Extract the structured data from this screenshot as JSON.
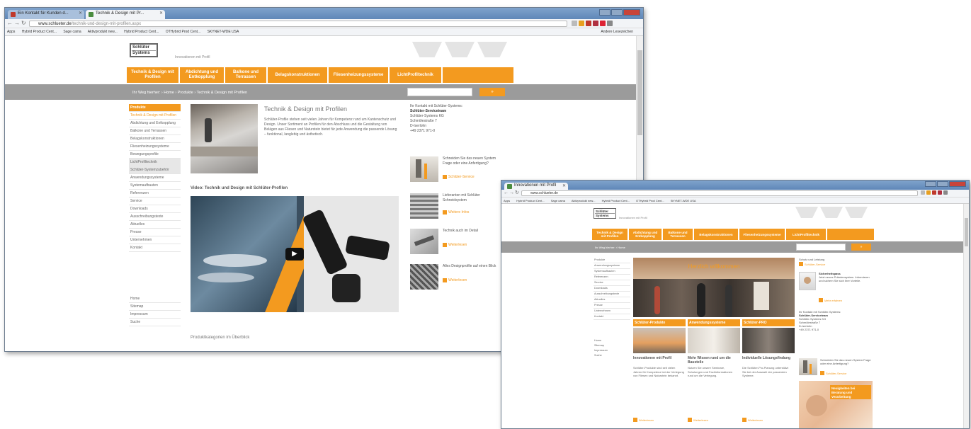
{
  "colors": {
    "accent": "#f39a1f",
    "gray_bar": "#9b9b9b",
    "titlebar": "#6b8fbf"
  },
  "window1": {
    "tabs": [
      {
        "label": "Ein Kontakt für Kunden d..."
      },
      {
        "label": "Technik & Design mit Pr..."
      }
    ],
    "url_domain": "www.schlueter.de",
    "url_path": "/technik-und-design-mit-profilen.aspx",
    "bookmarks": [
      "Apps",
      "Hybrid Product Cent...",
      "Sage cama",
      "Aktivprodukt new...",
      "Hybrid Product Cent...",
      "OTHybrid Prod Cent...",
      "SKYNET-WDE USA"
    ],
    "other_bookmarks": "Andere Lesezeichen",
    "site": {
      "logo_line1": "Schlüter",
      "logo_line2": "Systems",
      "tagline": "Innovationen mit Profil",
      "nav": [
        "Technik & Design mit Profilen",
        "Abdichtung und Entkopplung",
        "Balkone und Terrassen",
        "Belagskonstruktionen",
        "Fliesenheizungssysteme",
        "LichtProfiltechnik"
      ],
      "breadcrumb": "Ihr Weg hierher: › Home › Produkte › Technik & Design mit Profilen",
      "search_button": "»",
      "sidebar": [
        {
          "label": "Produkte",
          "style": "head"
        },
        {
          "label": "Technik & Design mit Profilen",
          "style": "sel"
        },
        {
          "label": "Abdichtung und Entkopplung",
          "style": ""
        },
        {
          "label": "Balkone und Terrassen",
          "style": ""
        },
        {
          "label": "Belagskonstruktionen",
          "style": ""
        },
        {
          "label": "Fliesenheizungssysteme",
          "style": ""
        },
        {
          "label": "Bewegungsprofile",
          "style": ""
        },
        {
          "label": "LichtProfiltechnik",
          "style": "gray"
        },
        {
          "label": "Schlüter-Systemzubehör",
          "style": "gray"
        },
        {
          "label": "Anwendungssysteme",
          "style": ""
        },
        {
          "label": "Systemaufbauten",
          "style": ""
        },
        {
          "label": "Referenzen",
          "style": ""
        },
        {
          "label": "Service",
          "style": ""
        },
        {
          "label": "Downloads",
          "style": ""
        },
        {
          "label": "Ausschreibungstexte",
          "style": ""
        },
        {
          "label": "Aktuelles",
          "style": ""
        },
        {
          "label": "Presse",
          "style": ""
        },
        {
          "label": "Unternehmen",
          "style": ""
        },
        {
          "label": "Kontakt",
          "style": ""
        }
      ],
      "sidebar_bottom": [
        "Home",
        "Sitemap",
        "Impressum",
        "Suche"
      ],
      "heading": "Technik & Design mit Profilen",
      "intro": "Schlüter-Profile stehen seit vielen Jahren für Kompetenz rund um Kantenschutz und Design. Unser Sortiment an Profilen für den Abschluss und die Gestaltung von Belägen aus Fliesen und Naturstein bietet für jede Anwendung die passende Lösung – funktional, langlebig und ästhetisch.",
      "video_label": "Video: Technik und Design mit Schlüter-Profilen",
      "bottom_label": "Produktkategorien im Überblick",
      "contact": {
        "title": "Ihr Kontakt mit Schlüter-Systems:",
        "name": "Schlüter-Serviceteam",
        "company": "Schlüter-Systems KG",
        "street": "Schmölestraße 7",
        "city": "D-Iserlohn",
        "phone": "+49 2371 971-0"
      },
      "side_items": [
        {
          "text": "Schneiden Sie das neuen System Frage oder eine Anfertigung?",
          "link": "Schlüter-Service"
        },
        {
          "text": "Lieferanten mit Schlüter Schneidsystem",
          "link": "Weitere Infos"
        },
        {
          "text": "Technik auch im Detail",
          "link": "Weiterlesen"
        },
        {
          "text": "Alles Designprofile auf einen Blick",
          "link": "Weiterlesen"
        }
      ]
    }
  },
  "window2": {
    "tab": "Innovationen mit Profil",
    "url_domain": "www.schlueter.de",
    "bookmarks": [
      "Apps",
      "Hybrid Product Cent...",
      "Sage cama",
      "Aktivprodukt new...",
      "Hybrid Product Cent...",
      "OTHybrid Prod Cent...",
      "SKYNET-WDE USA"
    ],
    "site": {
      "logo_line1": "Schlüter",
      "logo_line2": "Systems",
      "tagline": "Innovationen mit Profil",
      "nav": [
        "Technik & Design mit Profilen",
        "Abdichtung und Entkopplung",
        "Balkone und Terrassen",
        "Belagskonstruktionen",
        "Fliesenheizungssysteme",
        "LichtProfiltechnik"
      ],
      "breadcrumb": "Ihr Weg hierher: › Home",
      "search_button": "»",
      "sidebar": [
        "Produkte",
        "Anwendungssysteme",
        "Systemaufbauten",
        "Referenzen",
        "Service",
        "Downloads",
        "Ausschreibungstexte",
        "Aktuelles",
        "Presse",
        "Unternehmen",
        "Kontakt"
      ],
      "sidebar_bottom": [
        "Home",
        "Sitemap",
        "Impressum",
        "Suche"
      ],
      "banner_caption": "Herzlich willkommen",
      "features": [
        {
          "head": "Schlüter-Produkte",
          "title": "Innovationen mit Profil",
          "text": "Schlüter-Produkte sind seit vielen Jahren für Kompetenz bei der Verlegung von Fliesen und Naturstein bekannt."
        },
        {
          "head": "Anwendungssysteme",
          "title": "Mehr Wissen rund um die Baustelle",
          "text": "Nutzen Sie unsere Seminare, Schulungen und Fachinformationen rund um die Verlegung."
        },
        {
          "head": "Schlüter-PRO",
          "title": "Individuelle Lösungsfindung",
          "text": "Die Schlüter-Pro-Planung unterstützt Sie bei der Auswahl der passenden Systeme."
        }
      ],
      "feature_link": "Weiterlesen",
      "right": {
        "top": "Schutz und Leistung",
        "top_link": "Schlüter-Service",
        "news_title": "Sicherheitspass",
        "news_text": "Jetzt neues Prämiensystem. Informieren und sichern Sie sich Ihre Vorteile.",
        "news_link": "Mehr erfahren",
        "contact_title": "Ihr Kontakt mit Schlüter-Systems:",
        "contact_name": "Schlüter-Serviceteam",
        "contact_company": "Schlüter-Systems KG",
        "contact_street": "Schmölestraße 7",
        "contact_city": "D-Iserlohn",
        "contact_phone": "+49 2371 971-0",
        "q_text": "Schneiden Sie das neuen System Frage oder eine Anfertigung?",
        "q_link": "Schlüter-Service",
        "promo": "Neuigkeiten bei Beratung und Verarbeitung"
      }
    }
  }
}
